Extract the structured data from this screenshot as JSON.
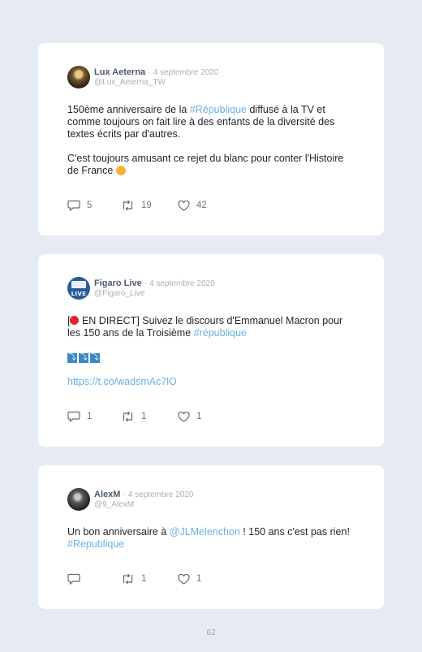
{
  "tweets": [
    {
      "author": "Lux Aeterna",
      "separator": "·",
      "date": "4 septembre 2020",
      "handle": "@Lux_Aeterna_TW",
      "text": {
        "l1a": "150ème anniversaire de la ",
        "l1link": "#République",
        "l1b": " diffusé à la TV et comme toujours on fait lire à des enfants de la diversité des textes écrits par d'autres.",
        "l2": "C'est toujours amusant ce rejet du blanc pour conter l'Histoire de France "
      },
      "replies": "5",
      "retweets": "19",
      "likes": "42"
    },
    {
      "author": "Figaro Live",
      "separator": "·",
      "date": "4 septembre 2020",
      "handle": "@Figaro_Live",
      "avatar_label": "LIVE",
      "text": {
        "l1a": "[",
        "l1b": " EN DIRECT] Suivez le discours d'Emmanuel Macron pour les 150 ans de la Troisième ",
        "l1link": "#république",
        "arrow_glyph": "⤵",
        "url": "https://t.co/wadsmAc7lO"
      },
      "replies": "1",
      "retweets": "1",
      "likes": "1"
    },
    {
      "author": "AlexM",
      "separator": "·",
      "date": "4 septembre 2020",
      "handle": "@9_AlexM",
      "text": {
        "l1a": "Un bon anniversaire à ",
        "l1mention": "@JLMelenchon",
        "l1b": " ! 150 ans c'est pas rien! ",
        "l1link": "#Republique"
      },
      "replies": "",
      "retweets": "1",
      "likes": "1"
    }
  ],
  "page_number": "62",
  "colors": {
    "link": "#6ab2e4",
    "background": "#e6ebf3",
    "card": "#ffffff"
  },
  "icons": [
    "reply-icon",
    "retweet-icon",
    "heart-icon"
  ]
}
